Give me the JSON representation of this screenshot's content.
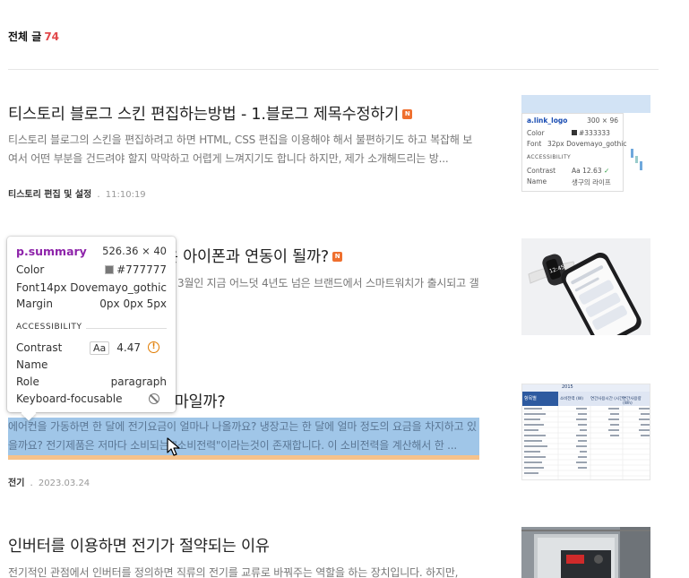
{
  "list_header": {
    "label": "전체 글",
    "count": "74"
  },
  "posts": [
    {
      "title": "티스토리 블로그 스킨 편집하는방법 - 1.블로그 제목수정하기",
      "badge": "N",
      "summary": "티스토리 블로그의 스킨을 편집하려고 하면 HTML, CSS 편집을 이용해야 해서 불편하기도 하고 복잡해 보여서 어떤 부분을 건드려야 할지 막막하고 어렵게 느껴지기도 합니다 하지만, 제가 소개해드리는 방...",
      "category": "티스토리 편집 및 설정",
      "time": "11:10:19"
    },
    {
      "title": "갤럭시 핏1은? 갤럭시핏은 아이폰과 연동이 될까?",
      "badge": "N",
      "summary": "갤럭시 핏 1입니다 글을 쓰는 2023년 3월인 지금 어느덧 4년도 넘은 브랜드에서 스마트워치가 출시되고 갤럭시 핏 1을 이어 갤럭시 핏...",
      "category": "",
      "time": ""
    },
    {
      "title": "우리집 한달전기요금은 얼마일까?",
      "summary": "에어컨을 가동하면 한 달에 전기요금이 얼마나 나올까요? 냉장고는 한 달에 얼마 정도의 요금을 차지하고 있을까요? 전기제품은 저마다 소비되는 \"소비전력\"이라는것이 존재합니다. 이 소비전력을 계산해서 한 ...",
      "category": "전기",
      "time": "2023.03.24"
    },
    {
      "title": "인버터를 이용하면 전기가 절약되는 이유",
      "summary": "전기적인 관점에서 인버터를 정의하면 직류의 전기를 교류로 바꿔주는 역할을 하는 장치입니다. 하지만,"
    }
  ],
  "thumb_tooltip": {
    "selector": "a.link_logo",
    "size": "300 × 96",
    "color_label": "Color",
    "color_value": "#333333",
    "font_label": "Font",
    "font_value": "32px Dovemayo_gothic",
    "section": "ACCESSIBILITY",
    "contrast_label": "Contrast",
    "contrast_value": "12.63",
    "name_label": "Name",
    "name_value": "생구의 라이프"
  },
  "inspector_tooltip": {
    "selector": "p.summary",
    "size": "526.36 × 40",
    "color_label": "Color",
    "color_value": "#777777",
    "font_label": "Font",
    "font_value": "14px Dovemayo_gothic",
    "margin_label": "Margin",
    "margin_value": "0px 0px 5px",
    "section": "ACCESSIBILITY",
    "contrast_label": "Contrast",
    "contrast_aa": "Aa",
    "contrast_value": "4.47",
    "name_label": "Name",
    "name_value": "",
    "role_label": "Role",
    "role_value": "paragraph",
    "keyboard_label": "Keyboard-focusable"
  },
  "table_thumb": {
    "year": "2015",
    "header": "항목별",
    "col1": "소비전력 (W)",
    "col2": "연간사용시간 (시간)",
    "col3": "연간사용량 (Wh)"
  },
  "colors": {
    "accent_count": "#e1484a",
    "badge": "#ef6f2e",
    "highlight_content": "#6fa8dc",
    "highlight_margin": "#f6c28b",
    "summary_text": "#777777"
  }
}
